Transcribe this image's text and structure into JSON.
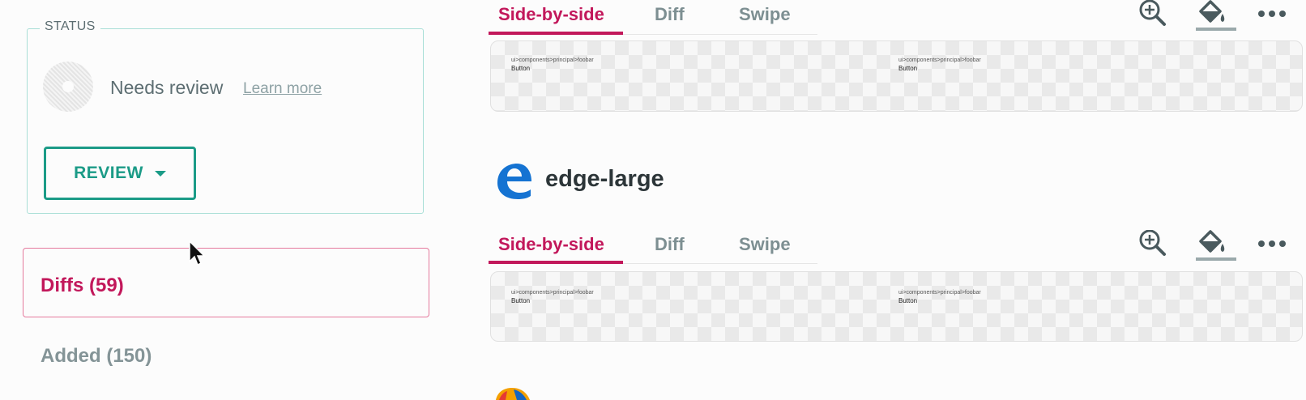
{
  "status": {
    "legend": "STATUS",
    "state_text": "Needs review",
    "learn_more": "Learn more",
    "review_button": "REVIEW"
  },
  "nav": {
    "diffs": "Diffs (59)",
    "added": "Added (150)"
  },
  "tabs": [
    "Side-by-side",
    "Diff",
    "Swipe"
  ],
  "panels": [
    {
      "left": {
        "path": "ui>components>principal>foobar",
        "label": "Button"
      },
      "right": {
        "path": "ui>components>principal>foobar",
        "label": "Button"
      }
    },
    {
      "left": {
        "path": "ui>components>principal>foobar",
        "label": "Button"
      },
      "right": {
        "path": "ui>components>principal>foobar",
        "label": "Button"
      }
    }
  ],
  "browser_section": {
    "name": "edge-large",
    "icon": "edge-browser-icon"
  },
  "colors": {
    "accent": "#c2185b",
    "review": "#1b9b87",
    "muted": "#7d8f92"
  },
  "icons": [
    "zoom-in-icon",
    "paint-bucket-icon",
    "more-horizontal-icon",
    "cursor-icon",
    "firefox-icon"
  ]
}
